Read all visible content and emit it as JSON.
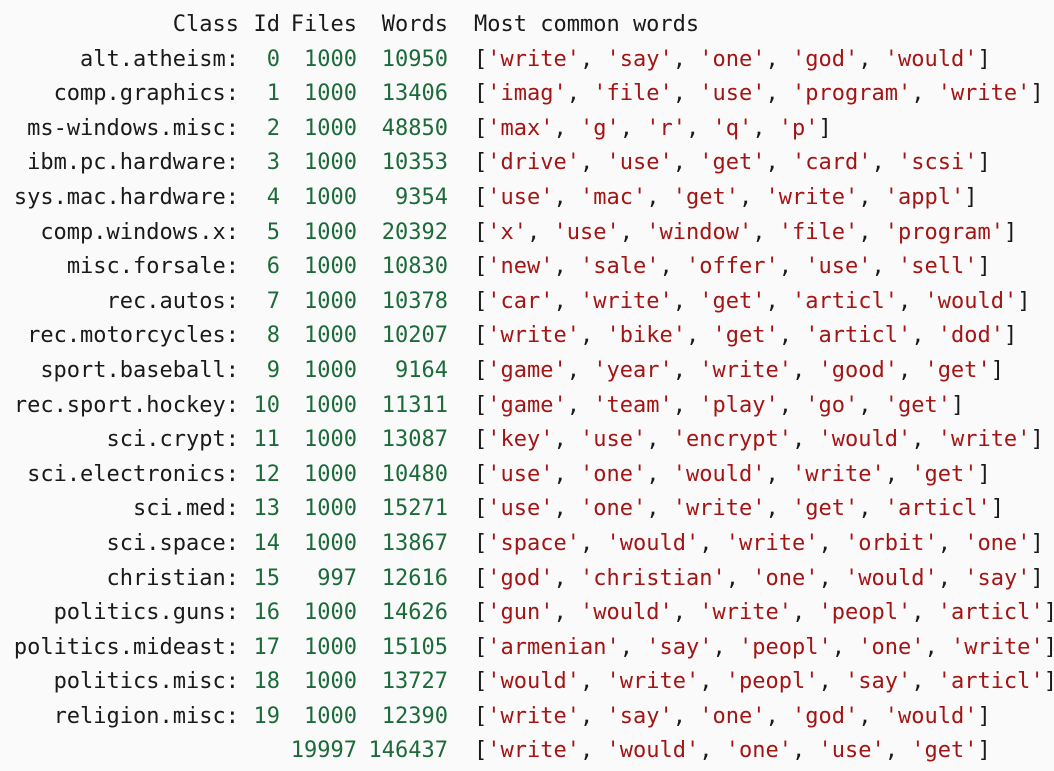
{
  "header": {
    "class": "Class",
    "id": "Id",
    "files": "Files",
    "words": "Words",
    "most": "Most common words"
  },
  "rows": [
    {
      "class": "alt.atheism:",
      "id": "0",
      "files": "1000",
      "words": "10950",
      "most": [
        "write",
        "say",
        "one",
        "god",
        "would"
      ]
    },
    {
      "class": "comp.graphics:",
      "id": "1",
      "files": "1000",
      "words": "13406",
      "most": [
        "imag",
        "file",
        "use",
        "program",
        "write"
      ]
    },
    {
      "class": "ms-windows.misc:",
      "id": "2",
      "files": "1000",
      "words": "48850",
      "most": [
        "max",
        "g",
        "r",
        "q",
        "p"
      ]
    },
    {
      "class": "ibm.pc.hardware:",
      "id": "3",
      "files": "1000",
      "words": "10353",
      "most": [
        "drive",
        "use",
        "get",
        "card",
        "scsi"
      ]
    },
    {
      "class": "sys.mac.hardware:",
      "id": "4",
      "files": "1000",
      "words": "9354",
      "most": [
        "use",
        "mac",
        "get",
        "write",
        "appl"
      ]
    },
    {
      "class": "comp.windows.x:",
      "id": "5",
      "files": "1000",
      "words": "20392",
      "most": [
        "x",
        "use",
        "window",
        "file",
        "program"
      ]
    },
    {
      "class": "misc.forsale:",
      "id": "6",
      "files": "1000",
      "words": "10830",
      "most": [
        "new",
        "sale",
        "offer",
        "use",
        "sell"
      ]
    },
    {
      "class": "rec.autos:",
      "id": "7",
      "files": "1000",
      "words": "10378",
      "most": [
        "car",
        "write",
        "get",
        "articl",
        "would"
      ]
    },
    {
      "class": "rec.motorcycles:",
      "id": "8",
      "files": "1000",
      "words": "10207",
      "most": [
        "write",
        "bike",
        "get",
        "articl",
        "dod"
      ]
    },
    {
      "class": "sport.baseball:",
      "id": "9",
      "files": "1000",
      "words": "9164",
      "most": [
        "game",
        "year",
        "write",
        "good",
        "get"
      ]
    },
    {
      "class": "rec.sport.hockey:",
      "id": "10",
      "files": "1000",
      "words": "11311",
      "most": [
        "game",
        "team",
        "play",
        "go",
        "get"
      ]
    },
    {
      "class": "sci.crypt:",
      "id": "11",
      "files": "1000",
      "words": "13087",
      "most": [
        "key",
        "use",
        "encrypt",
        "would",
        "write"
      ]
    },
    {
      "class": "sci.electronics:",
      "id": "12",
      "files": "1000",
      "words": "10480",
      "most": [
        "use",
        "one",
        "would",
        "write",
        "get"
      ]
    },
    {
      "class": "sci.med:",
      "id": "13",
      "files": "1000",
      "words": "15271",
      "most": [
        "use",
        "one",
        "write",
        "get",
        "articl"
      ]
    },
    {
      "class": "sci.space:",
      "id": "14",
      "files": "1000",
      "words": "13867",
      "most": [
        "space",
        "would",
        "write",
        "orbit",
        "one"
      ]
    },
    {
      "class": "christian:",
      "id": "15",
      "files": "997",
      "words": "12616",
      "most": [
        "god",
        "christian",
        "one",
        "would",
        "say"
      ]
    },
    {
      "class": "politics.guns:",
      "id": "16",
      "files": "1000",
      "words": "14626",
      "most": [
        "gun",
        "would",
        "write",
        "peopl",
        "articl"
      ]
    },
    {
      "class": "politics.mideast:",
      "id": "17",
      "files": "1000",
      "words": "15105",
      "most": [
        "armenian",
        "say",
        "peopl",
        "one",
        "write"
      ]
    },
    {
      "class": "politics.misc:",
      "id": "18",
      "files": "1000",
      "words": "13727",
      "most": [
        "would",
        "write",
        "peopl",
        "say",
        "articl"
      ]
    },
    {
      "class": "religion.misc:",
      "id": "19",
      "files": "1000",
      "words": "12390",
      "most": [
        "write",
        "say",
        "one",
        "god",
        "would"
      ]
    }
  ],
  "total": {
    "class": "",
    "id": "",
    "files": "19997",
    "words": "146437",
    "most": [
      "write",
      "would",
      "one",
      "use",
      "get"
    ]
  },
  "colors": {
    "numbers": "#1c6a3a",
    "strings": "#a31515",
    "text": "#1a1a1a",
    "background": "#fafafa"
  }
}
